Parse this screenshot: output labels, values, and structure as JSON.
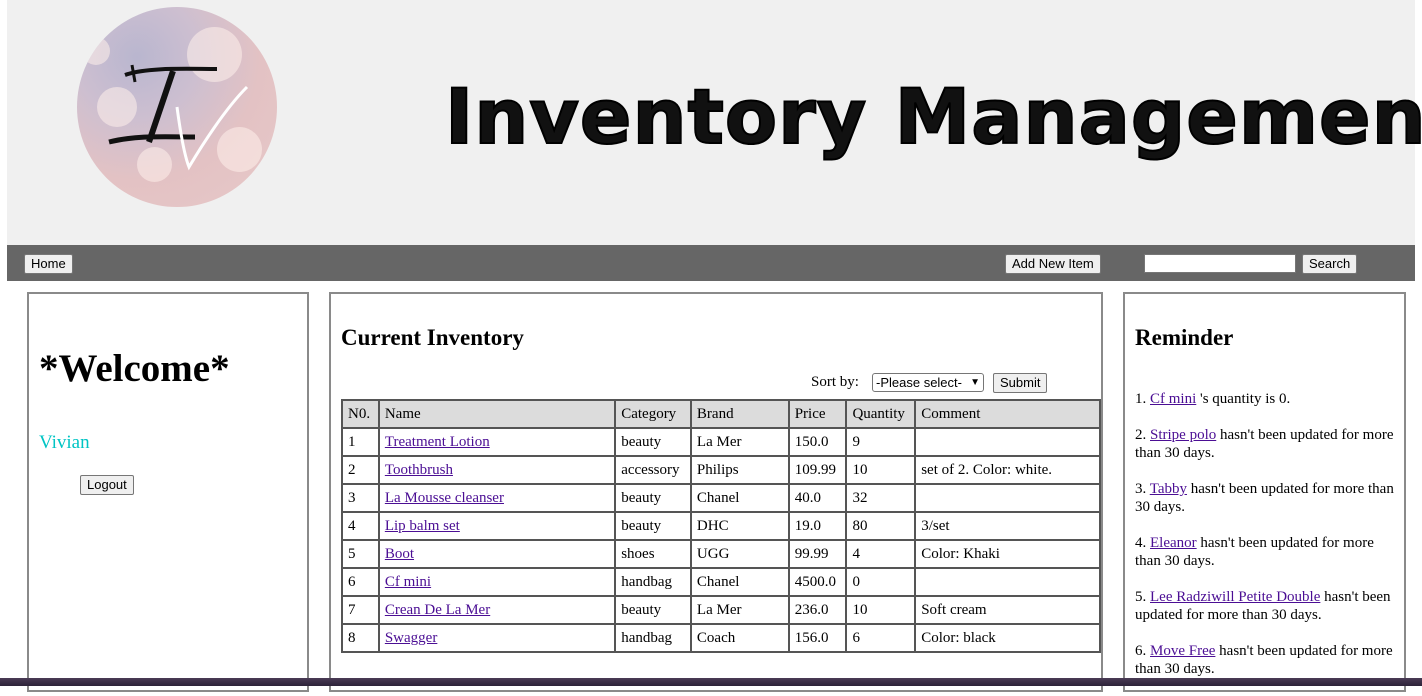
{
  "banner": {
    "title": "Inventory Management",
    "logo_icon": "iv-monogram-logo-icon"
  },
  "nav": {
    "home_label": "Home",
    "add_item_label": "Add New Item",
    "search_value": "",
    "search_label": "Search"
  },
  "sidebar": {
    "welcome": "*Welcome*",
    "user": "Vivian",
    "logout_label": "Logout"
  },
  "inventory": {
    "title": "Current Inventory",
    "sort_label": "Sort by:",
    "sort_selected": "-Please select-",
    "submit_label": "Submit",
    "columns": [
      "N0.",
      "Name",
      "Category",
      "Brand",
      "Price",
      "Quantity",
      "Comment"
    ],
    "rows": [
      {
        "no": "1",
        "name": "Treatment Lotion",
        "category": "beauty",
        "brand": "La Mer",
        "price": "150.0",
        "quantity": "9",
        "comment": ""
      },
      {
        "no": "2",
        "name": "Toothbrush",
        "category": "accessory",
        "brand": "Philips",
        "price": "109.99",
        "quantity": "10",
        "comment": "set of 2. Color: white."
      },
      {
        "no": "3",
        "name": "La Mousse cleanser",
        "category": "beauty",
        "brand": "Chanel",
        "price": "40.0",
        "quantity": "32",
        "comment": ""
      },
      {
        "no": "4",
        "name": "Lip balm set",
        "category": "beauty",
        "brand": "DHC",
        "price": "19.0",
        "quantity": "80",
        "comment": "3/set"
      },
      {
        "no": "5",
        "name": "Boot",
        "category": "shoes",
        "brand": "UGG",
        "price": "99.99",
        "quantity": "4",
        "comment": "Color: Khaki"
      },
      {
        "no": "6",
        "name": "Cf mini",
        "category": "handbag",
        "brand": "Chanel",
        "price": "4500.0",
        "quantity": "0",
        "comment": ""
      },
      {
        "no": "7",
        "name": "Crean De La Mer",
        "category": "beauty",
        "brand": "La Mer",
        "price": "236.0",
        "quantity": "10",
        "comment": "Soft cream"
      },
      {
        "no": "8",
        "name": "Swagger",
        "category": "handbag",
        "brand": "Coach",
        "price": "156.0",
        "quantity": "6",
        "comment": "Color: black"
      }
    ]
  },
  "reminder": {
    "title": "Reminder",
    "items": [
      {
        "prefix": "1. ",
        "link": "Cf mini",
        "text": " 's quantity is 0."
      },
      {
        "prefix": "2. ",
        "link": "Stripe polo",
        "text": " hasn't been updated for more than 30 days."
      },
      {
        "prefix": "3. ",
        "link": "Tabby",
        "text": " hasn't been updated for more than 30 days."
      },
      {
        "prefix": "4. ",
        "link": "Eleanor",
        "text": " hasn't been updated for more than 30 days."
      },
      {
        "prefix": "5. ",
        "link": "Lee Radziwill Petite Double",
        "text": " hasn't been updated for more than 30 days."
      },
      {
        "prefix": "6. ",
        "link": "Move Free",
        "text": " hasn't been updated for more than 30 days."
      }
    ]
  }
}
